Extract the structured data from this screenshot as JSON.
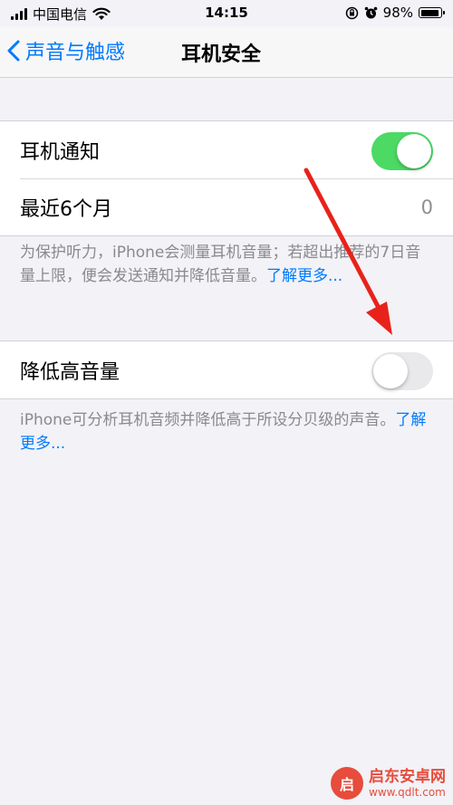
{
  "status_bar": {
    "carrier": "中国电信",
    "time": "14:15",
    "battery_percent": "98%"
  },
  "nav": {
    "back_label": "声音与触感",
    "title": "耳机安全"
  },
  "notifications_group": {
    "toggle_label": "耳机通知",
    "toggle_on": true,
    "recent_label": "最近6个月",
    "recent_value": "0",
    "footer_text": "为保护听力，iPhone会测量耳机音量；若超出推荐的7日音量上限，便会发送通知并降低音量。",
    "footer_link": "了解更多..."
  },
  "reduce_group": {
    "toggle_label": "降低高音量",
    "toggle_on": false,
    "footer_text": "iPhone可分析耳机音频并降低高于所设分贝级的声音。",
    "footer_link": "了解更多..."
  },
  "annotation": {
    "arrow_color": "#e8221b"
  },
  "watermark": {
    "name": "启东安卓网",
    "url": "www.qdlt.com"
  },
  "colors": {
    "accent": "#007aff",
    "toggle_on": "#4cd964",
    "background": "#f2f2f7"
  }
}
